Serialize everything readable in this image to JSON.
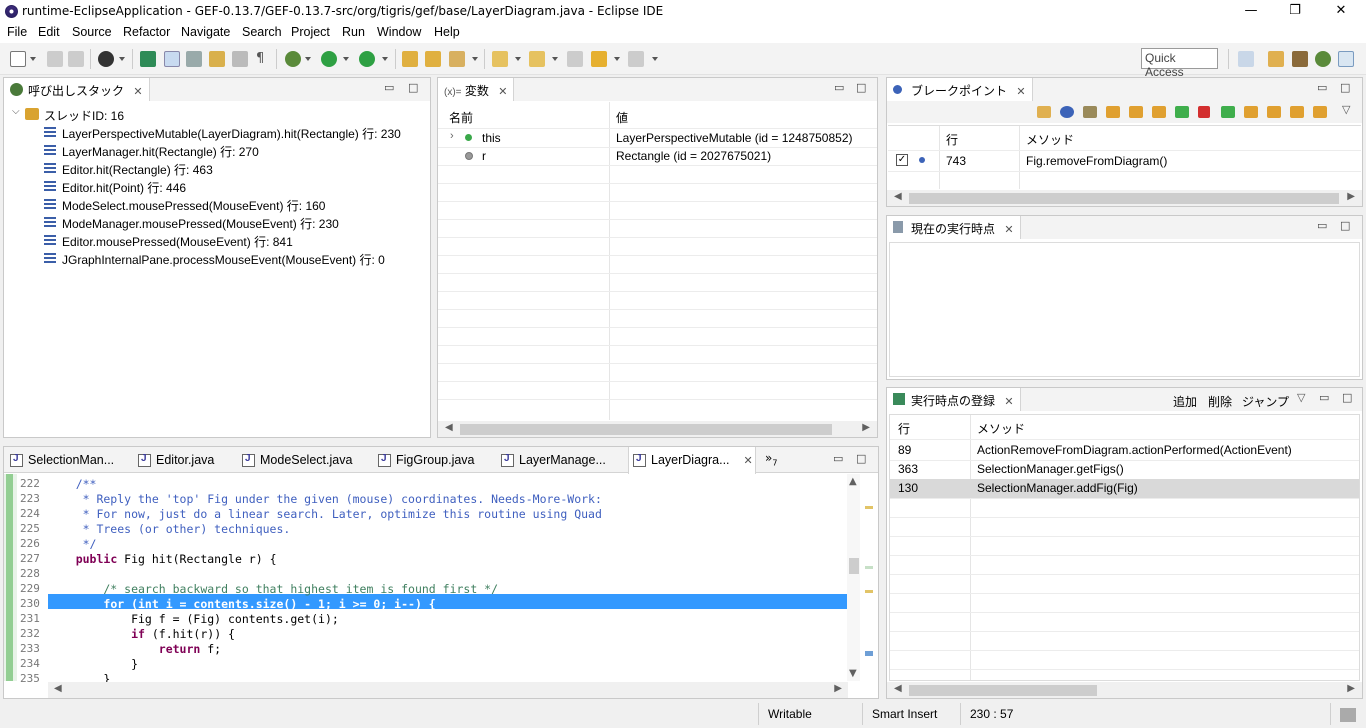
{
  "window": {
    "title": "runtime-EclipseApplication - GEF-0.13.7/GEF-0.13.7-src/org/tigris/gef/base/LayerDiagram.java - Eclipse IDE",
    "minimize": "—",
    "maximize": "❐",
    "close": "✕"
  },
  "menu": [
    "File",
    "Edit",
    "Source",
    "Refactor",
    "Navigate",
    "Search",
    "Project",
    "Run",
    "Window",
    "Help"
  ],
  "toolbar": {
    "quick_access": "Quick Access"
  },
  "callstack": {
    "tab": "呼び出しスタック",
    "thread": "スレッドID: 16",
    "frames": [
      "LayerPerspectiveMutable(LayerDiagram).hit(Rectangle) 行: 230",
      "LayerManager.hit(Rectangle) 行: 270",
      "Editor.hit(Rectangle) 行: 463",
      "Editor.hit(Point) 行: 446",
      "ModeSelect.mousePressed(MouseEvent) 行: 160",
      "ModeManager.mousePressed(MouseEvent) 行: 230",
      "Editor.mousePressed(MouseEvent) 行: 841",
      "JGraphInternalPane.processMouseEvent(MouseEvent) 行: 0"
    ]
  },
  "variables": {
    "tab": "変数",
    "tab_prefix": "(x)=",
    "col_name": "名前",
    "col_value": "値",
    "rows": [
      {
        "name": "this",
        "value": "LayerPerspectiveMutable  (id = 1248750852)"
      },
      {
        "name": "r",
        "value": "Rectangle  (id = 2027675021)"
      }
    ]
  },
  "breakpoints": {
    "tab": "ブレークポイント",
    "col_line": "行",
    "col_method": "メソッド",
    "rows": [
      {
        "line": "743",
        "method": "Fig.removeFromDiagram()"
      }
    ]
  },
  "current_point": {
    "tab": "現在の実行時点"
  },
  "registered_points": {
    "tab": "実行時点の登録",
    "actions": [
      "追加",
      "削除",
      "ジャンプ"
    ],
    "col_line": "行",
    "col_method": "メソッド",
    "rows": [
      {
        "line": "89",
        "method": "ActionRemoveFromDiagram.actionPerformed(ActionEvent)"
      },
      {
        "line": "363",
        "method": "SelectionManager.getFigs()"
      },
      {
        "line": "130",
        "method": "SelectionManager.addFig(Fig)"
      }
    ]
  },
  "editor": {
    "tabs": [
      "SelectionMan...",
      "Editor.java",
      "ModeSelect.java",
      "FigGroup.java",
      "LayerManage...",
      "LayerDiagra..."
    ],
    "overflow": "»",
    "overflow_count": "7",
    "lines": [
      {
        "n": "222",
        "text": "    /**",
        "cls": "cm"
      },
      {
        "n": "223",
        "text": "     * Reply the 'top' Fig under the given (mouse) coordinates. Needs-More-Work:",
        "cls": "cm"
      },
      {
        "n": "224",
        "text": "     * For now, just do a linear search. Later, optimize this routine using Quad",
        "cls": "cm"
      },
      {
        "n": "225",
        "text": "     * Trees (or other) techniques.",
        "cls": "cm"
      },
      {
        "n": "226",
        "text": "     */",
        "cls": "cm"
      },
      {
        "n": "227",
        "text": "",
        "cls": ""
      },
      {
        "n": "228",
        "text": "",
        "cls": ""
      },
      {
        "n": "229",
        "text": "        /* search backward so that highest item is found first */",
        "cls": "cm2"
      },
      {
        "n": "230",
        "text": "",
        "cls": ""
      },
      {
        "n": "231",
        "text": "            Fig f = (Fig) contents.get(i);",
        "cls": ""
      },
      {
        "n": "232",
        "text": "",
        "cls": ""
      },
      {
        "n": "233",
        "text": "",
        "cls": ""
      },
      {
        "n": "234",
        "text": "            }",
        "cls": ""
      },
      {
        "n": "235",
        "text": "        }",
        "cls": ""
      }
    ],
    "code_227_kw": "public",
    "code_227_rest": " Fig hit(Rectangle r) {",
    "code_230": "for (int i = contents.size() - 1; i >= 0; i--) {",
    "code_232_kw": "if",
    "code_232_rest": " (f.hit(r)) {",
    "code_233_kw": "return",
    "code_233_rest": " f;"
  },
  "status": {
    "writable": "Writable",
    "insert": "Smart Insert",
    "position": "230 : 57"
  }
}
